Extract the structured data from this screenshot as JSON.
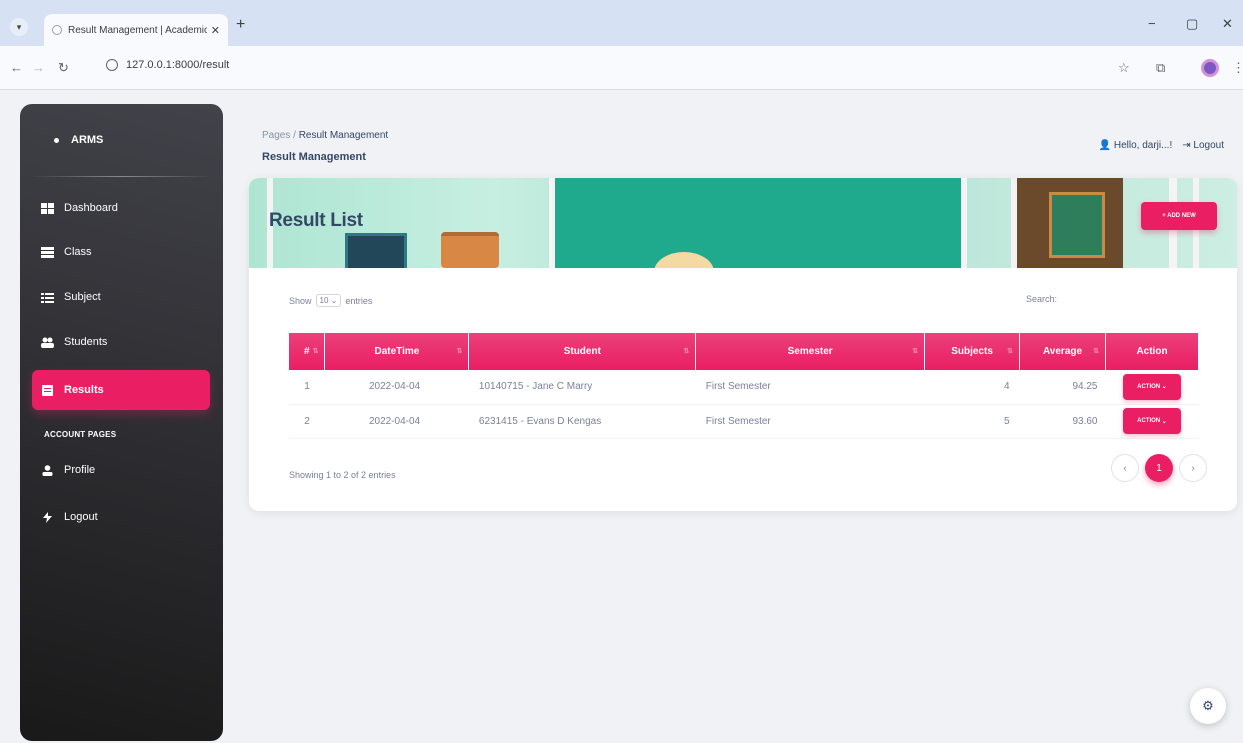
{
  "browser": {
    "tab_title": "Result Management | Academic",
    "url": "127.0.0.1:8000/result",
    "tab_close": "✕",
    "new_tab": "+",
    "minimize": "−",
    "restore": "▢",
    "close": "✕"
  },
  "sidebar": {
    "brand": "ARMS",
    "items": [
      {
        "label": "Dashboard",
        "icon": "dashboard-icon"
      },
      {
        "label": "Class",
        "icon": "table-icon"
      },
      {
        "label": "Subject",
        "icon": "list-icon"
      },
      {
        "label": "Students",
        "icon": "users-icon"
      },
      {
        "label": "Results",
        "icon": "receipt-icon",
        "active": true
      }
    ],
    "section_label": "ACCOUNT PAGES",
    "account_items": [
      {
        "label": "Profile",
        "icon": "person-icon"
      },
      {
        "label": "Logout",
        "icon": "logout-icon"
      }
    ]
  },
  "header": {
    "breadcrumb_root": "Pages",
    "breadcrumb_sep": "/",
    "breadcrumb_current": "Result Management",
    "title": "Result Management",
    "greeting": "Hello, darji...!",
    "logout": "Logout"
  },
  "card": {
    "title": "Result List",
    "add_button": "+ ADD NEW",
    "show_label": "Show",
    "entries_value": "10",
    "entries_label": "entries",
    "search_label": "Search:",
    "columns": [
      "#",
      "DateTime",
      "Student",
      "Semester",
      "Subjects",
      "Average",
      "Action"
    ],
    "rows": [
      {
        "num": "1",
        "date": "2022-04-04",
        "student": "10140715 - Jane C Marry",
        "semester": "First Semester",
        "subjects": "4",
        "average": "94.25",
        "action": "ACTION"
      },
      {
        "num": "2",
        "date": "2022-04-04",
        "student": "6231415 - Evans D Kengas",
        "semester": "First Semester",
        "subjects": "5",
        "average": "93.60",
        "action": "ACTION"
      }
    ],
    "info": "Showing 1 to 2 of 2 entries",
    "pager": {
      "prev": "‹",
      "current": "1",
      "next": "›"
    }
  },
  "colors": {
    "accent": "#e91e63",
    "sidebar": "#1f1f23"
  }
}
